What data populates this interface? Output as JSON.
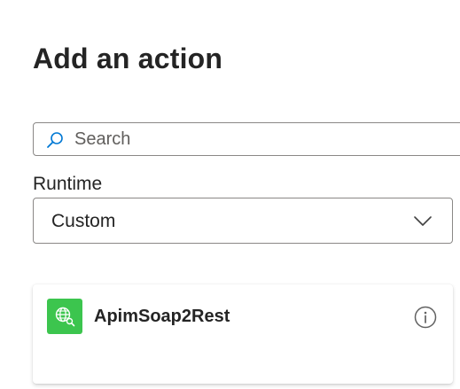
{
  "panel": {
    "title": "Add an action"
  },
  "search": {
    "placeholder": "Search",
    "value": "",
    "icon": "search-icon"
  },
  "runtime": {
    "label": "Runtime",
    "selected": "Custom",
    "icon": "chevron-down-icon"
  },
  "actions": [
    {
      "name": "ApimSoap2Rest",
      "icon": "globe-connector-icon",
      "icon_bg": "#3cc54e",
      "info_icon": "info-icon"
    }
  ],
  "colors": {
    "accent": "#0078d4",
    "connector_green": "#3cc54e",
    "border": "#8a8886",
    "text": "#242424"
  }
}
